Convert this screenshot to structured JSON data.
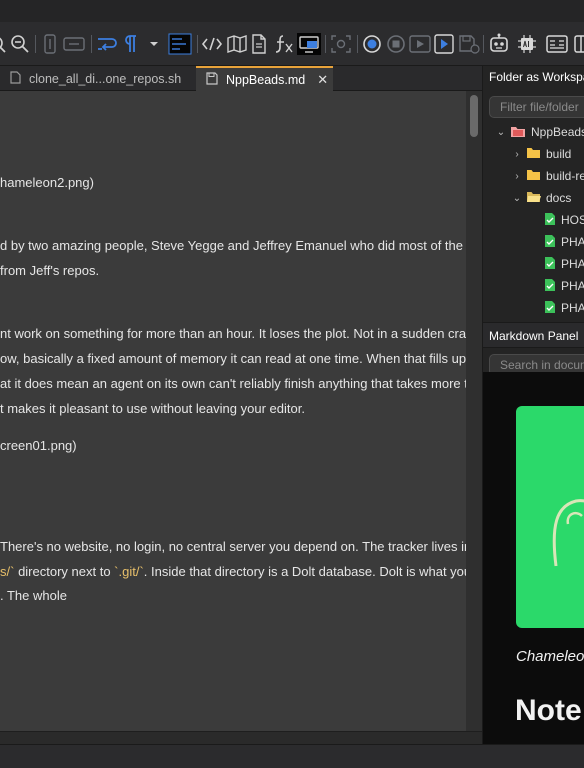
{
  "tabs": [
    {
      "label": "clone_all_di...one_repos.sh",
      "active": false
    },
    {
      "label": "NppBeads.md",
      "active": true
    }
  ],
  "editor": {
    "lines": [
      {
        "text": "hameleon2.png)"
      },
      {
        "text": "d by two amazing people, Steve Yegge and Jeffrey Emanuel who did most of the hea"
      },
      {
        "text": "from Jeff's repos."
      },
      {
        "text": "nt work on something for more than an hour. It loses the plot. Not in a sudden crash s"
      },
      {
        "text": "ow, basically a fixed amount of memory it can read at one time. When that fills up, the"
      },
      {
        "text": "at it does mean an agent on its own can't reliably finish anything that takes more than"
      },
      {
        "text": "t makes it pleasant to use without leaving your editor."
      },
      {
        "text": "creen01.png)"
      },
      {
        "text": " There's no website, no login, no central server you depend on. The tracker lives insi"
      },
      {
        "code1": "s/`",
        "mid": " directory next to ",
        "code2": "`.git/`",
        "rest": ". Inside that directory is a Dolt database. Dolt is what you'd g"
      },
      {
        "text": ". The whole"
      }
    ]
  },
  "folder_panel": {
    "title": "Folder as Workspace",
    "filter_placeholder": "Filter file/folder",
    "tree": [
      {
        "label": "NppBeads",
        "type": "root",
        "expanded": true
      },
      {
        "label": "build",
        "type": "folder",
        "expanded": false
      },
      {
        "label": "build-re",
        "type": "folder",
        "expanded": false
      },
      {
        "label": "docs",
        "type": "folder",
        "expanded": true
      },
      {
        "label": "HOS",
        "type": "file"
      },
      {
        "label": "PHA",
        "type": "file"
      },
      {
        "label": "PHA",
        "type": "file"
      },
      {
        "label": "PHA",
        "type": "file"
      },
      {
        "label": "PHA",
        "type": "file"
      }
    ]
  },
  "markdown_panel": {
    "title": "Markdown Panel",
    "search_placeholder": "Search in docum",
    "caption": "Chameleon",
    "heading": "Note"
  },
  "colors": {
    "accent_tab": "#e8a33a",
    "code_text": "#e8c06a",
    "preview_green": "#2bd96a",
    "editor_bg": "#3b3b3b"
  }
}
